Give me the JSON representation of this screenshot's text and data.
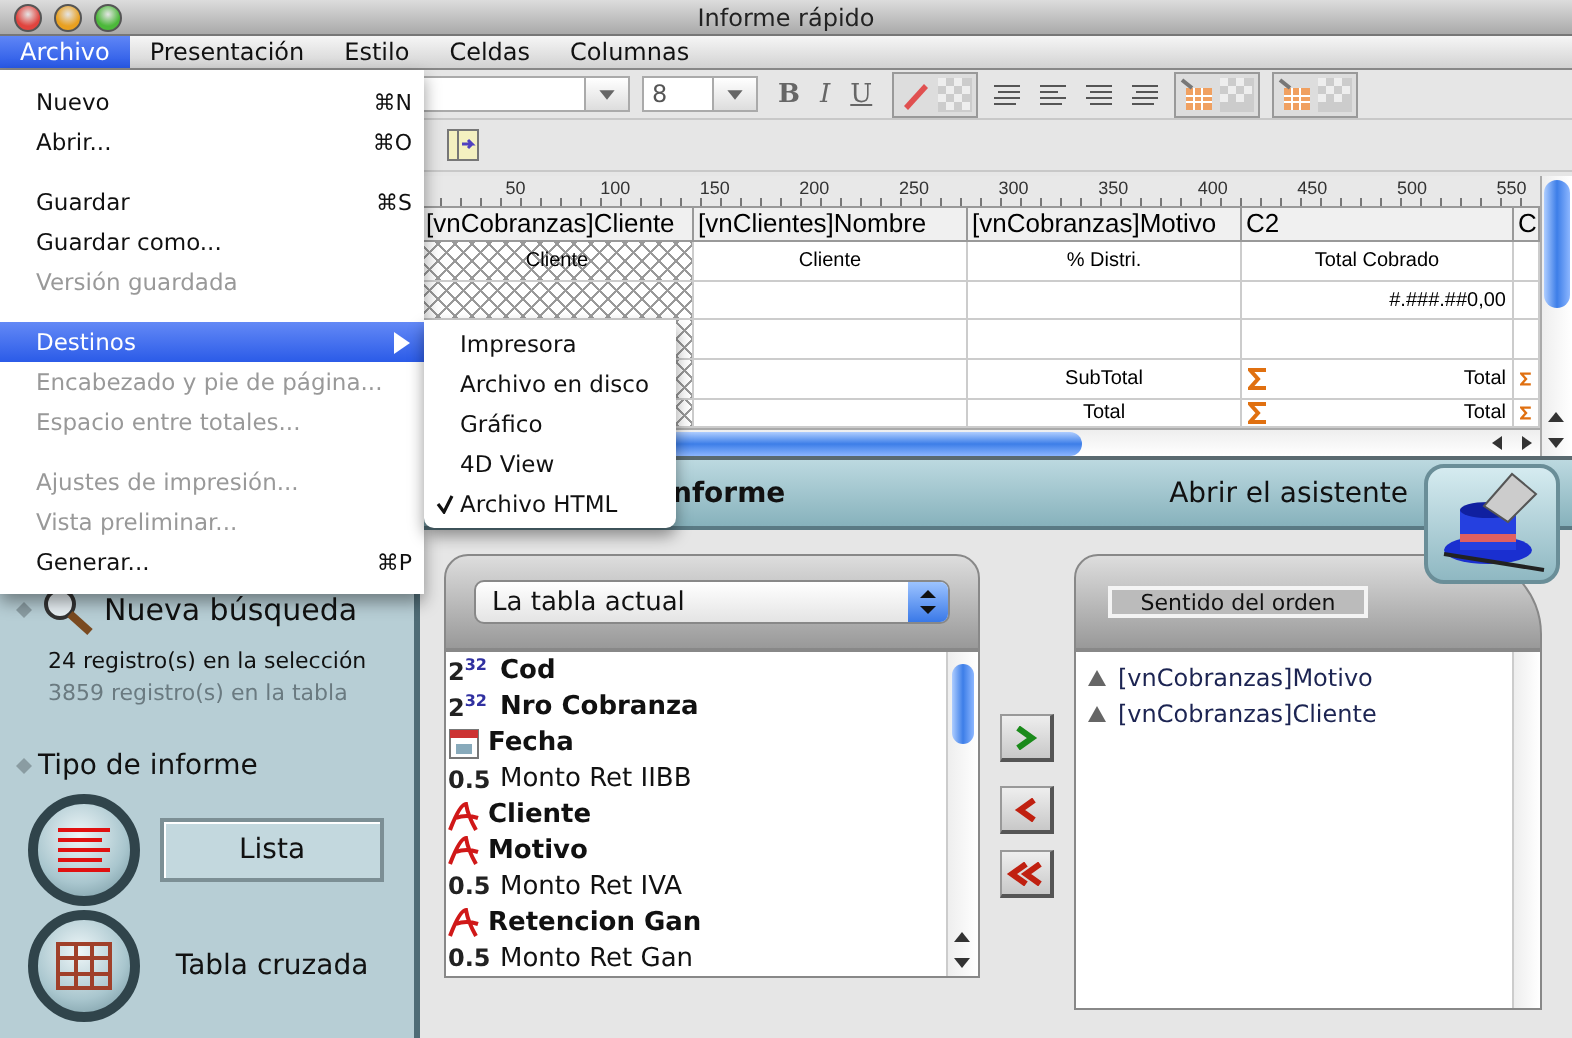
{
  "window": {
    "title": "Informe rápido"
  },
  "menu_bar": [
    {
      "label": "Archivo",
      "selected": true
    },
    {
      "label": "Presentación",
      "selected": false
    },
    {
      "label": "Estilo",
      "selected": false
    },
    {
      "label": "Celdas",
      "selected": false
    },
    {
      "label": "Columnas",
      "selected": false
    }
  ],
  "file_menu": {
    "groups": [
      {
        "items": [
          {
            "label": "Nuevo",
            "shortcut": "⌘N",
            "disabled": false,
            "selected": false
          },
          {
            "label": "Abrir...",
            "shortcut": "⌘O",
            "disabled": false,
            "selected": false
          }
        ]
      },
      {
        "items": [
          {
            "label": "Guardar",
            "shortcut": "⌘S",
            "disabled": false,
            "selected": false
          },
          {
            "label": "Guardar como...",
            "disabled": false,
            "selected": false
          },
          {
            "label": "Versión guardada",
            "disabled": true,
            "selected": false
          }
        ]
      },
      {
        "items": [
          {
            "label": "Destinos",
            "submenu": true,
            "disabled": false,
            "selected": true
          },
          {
            "label": "Encabezado y pie de página...",
            "disabled": true,
            "selected": false
          },
          {
            "label": "Espacio entre totales...",
            "disabled": true,
            "selected": false
          }
        ]
      },
      {
        "items": [
          {
            "label": "Ajustes de impresión...",
            "disabled": true,
            "selected": false
          },
          {
            "label": "Vista preliminar...",
            "disabled": true,
            "selected": false
          },
          {
            "label": "Generar...",
            "shortcut": "⌘P",
            "disabled": false,
            "selected": false
          }
        ]
      }
    ]
  },
  "destinations_submenu": [
    {
      "label": "Impresora",
      "checked": false
    },
    {
      "label": "Archivo en disco",
      "checked": false
    },
    {
      "label": "Gráfico",
      "checked": false
    },
    {
      "label": "4D View",
      "checked": false
    },
    {
      "label": "Archivo HTML",
      "checked": true
    }
  ],
  "toolbar": {
    "font_size": "8",
    "format_buttons": [
      "B",
      "I",
      "U"
    ]
  },
  "ruler": [
    "50",
    "100",
    "150",
    "200",
    "250",
    "300",
    "350",
    "400",
    "450",
    "500",
    "550"
  ],
  "table": {
    "columns": [
      {
        "label": "[vnCobranzas]Cliente",
        "hatched": true
      },
      {
        "label": "[vnClientes]Nombre",
        "hatched": false
      },
      {
        "label": "[vnCobranzas]Motivo",
        "hatched": false
      },
      {
        "label": "C2",
        "hatched": false
      },
      {
        "label": "C",
        "hatched": false
      }
    ],
    "rows": [
      [
        {
          "kind": "label",
          "text": "Cliente"
        },
        {
          "kind": "label",
          "text": "Cliente"
        },
        {
          "kind": "label",
          "text": "% Distri."
        },
        {
          "kind": "label",
          "text": "Total Cobrado"
        },
        {
          "kind": "label"
        }
      ],
      [
        {
          "kind": "label"
        },
        {
          "kind": "label"
        },
        {
          "kind": "label"
        },
        {
          "kind": "number",
          "text": "#.###.##0,00"
        },
        {
          "kind": "label"
        }
      ],
      [
        {
          "kind": "label"
        },
        {
          "kind": "label"
        },
        {
          "kind": "label"
        },
        {
          "kind": "label"
        },
        {
          "kind": "label"
        }
      ],
      [
        {
          "kind": "label"
        },
        {
          "kind": "label"
        },
        {
          "kind": "label",
          "text": "SubTotal"
        },
        {
          "kind": "sum",
          "text": "Total"
        },
        {
          "kind": "sum"
        }
      ],
      [
        {
          "kind": "label"
        },
        {
          "kind": "label"
        },
        {
          "kind": "label",
          "text": "Total"
        },
        {
          "kind": "sum",
          "text": "Total"
        },
        {
          "kind": "sum"
        }
      ]
    ]
  },
  "header": {
    "title": "nforme",
    "wizard": "Abrir el asistente"
  },
  "sidebar": {
    "search": "Nueva búsqueda",
    "selection_count": "24 registro(s) en la selección",
    "table_count": "3859 registro(s) en la tabla",
    "report_type": {
      "title": "Tipo de informe",
      "options": [
        {
          "label": "Lista",
          "kind": "list",
          "selected": true
        },
        {
          "label": "Tabla cruzada",
          "kind": "grid",
          "selected": false
        }
      ]
    }
  },
  "fields": {
    "table_select": "La tabla actual",
    "items": [
      {
        "kind": "integer",
        "badge": "2$^{32}$",
        "name": "Cod",
        "bold": true
      },
      {
        "kind": "integer",
        "badge": "2$^{32}$",
        "name": "Nro Cobranza",
        "bold": true
      },
      {
        "kind": "date",
        "name": "Fecha",
        "bold": true
      },
      {
        "kind": "real",
        "badge": "0.5",
        "name": "Monto Ret IIBB",
        "bold": false
      },
      {
        "kind": "alpha",
        "name": "Cliente",
        "bold": true
      },
      {
        "kind": "alpha",
        "name": "Motivo",
        "bold": true
      },
      {
        "kind": "real",
        "badge": "0.5",
        "name": "Monto Ret IVA",
        "bold": false
      },
      {
        "kind": "alpha",
        "name": "Retencion Gan",
        "bold": true
      },
      {
        "kind": "real",
        "badge": "0.5",
        "name": "Monto Ret Gan",
        "bold": false
      }
    ]
  },
  "sort": {
    "title": "Sentido del orden",
    "items": [
      "[vnCobranzas]Motivo",
      "[vnCobranzas]Cliente"
    ]
  }
}
